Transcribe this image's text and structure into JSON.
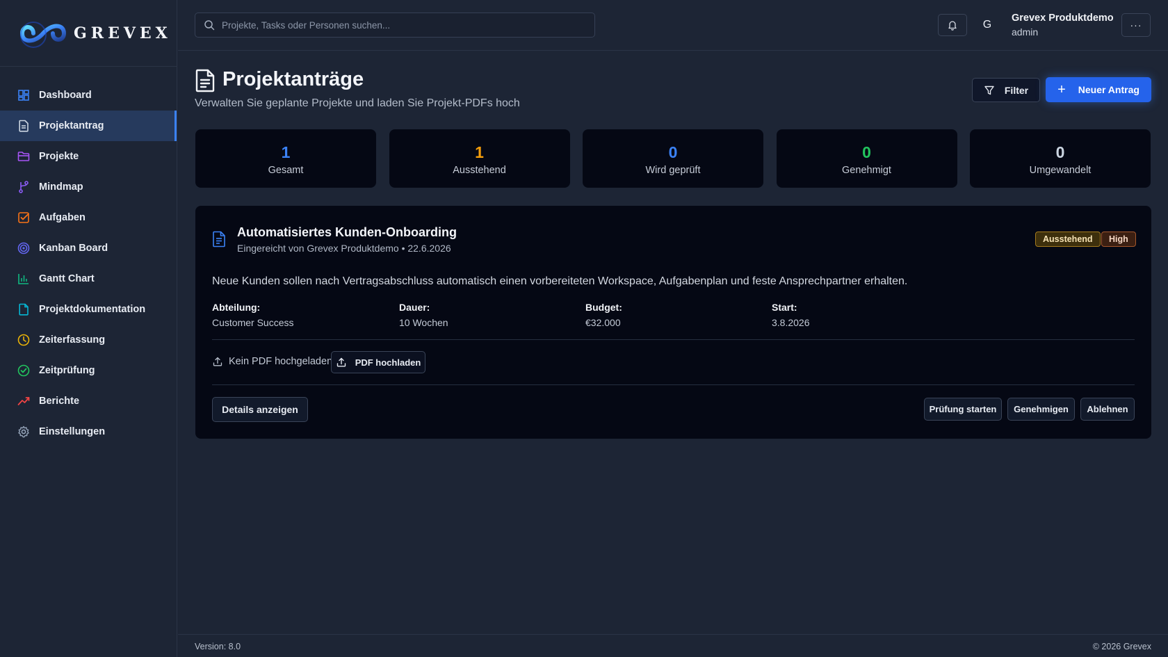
{
  "app": {
    "brand": "GREVEX"
  },
  "sidebar": {
    "items": [
      {
        "label": "Dashboard",
        "icon": "dashboard-icon",
        "color": "#3b82f6"
      },
      {
        "label": "Projektantrag",
        "icon": "document-icon",
        "color": "#cbd5e1",
        "active": true
      },
      {
        "label": "Projekte",
        "icon": "folder-icon",
        "color": "#a855f7"
      },
      {
        "label": "Mindmap",
        "icon": "branch-icon",
        "color": "#8b5cf6"
      },
      {
        "label": "Aufgaben",
        "icon": "checkbox-icon",
        "color": "#f97316"
      },
      {
        "label": "Kanban Board",
        "icon": "target-icon",
        "color": "#6366f1"
      },
      {
        "label": "Gantt Chart",
        "icon": "bar-chart-icon",
        "color": "#10b981"
      },
      {
        "label": "Projektdokumentation",
        "icon": "file-icon",
        "color": "#06b6d4"
      },
      {
        "label": "Zeiterfassung",
        "icon": "clock-icon",
        "color": "#eab308"
      },
      {
        "label": "Zeitprüfung",
        "icon": "check-circle-icon",
        "color": "#22c55e"
      },
      {
        "label": "Berichte",
        "icon": "trend-icon",
        "color": "#ef4444"
      },
      {
        "label": "Einstellungen",
        "icon": "gear-icon",
        "color": "#94a3b8"
      }
    ]
  },
  "topbar": {
    "search_placeholder": "Projekte, Tasks oder Personen suchen...",
    "avatar_letter": "G",
    "user_name": "Grevex Produktdemo",
    "user_role": "admin",
    "more_label": "···"
  },
  "page": {
    "title": "Projektanträge",
    "subtitle": "Verwalten Sie geplante Projekte und laden Sie Projekt-PDFs hoch",
    "filter_label": "Filter",
    "new_label": "Neuer Antrag"
  },
  "stats": [
    {
      "value": "1",
      "label": "Gesamt",
      "color": "#3b82f6"
    },
    {
      "value": "1",
      "label": "Ausstehend",
      "color": "#f59e0b"
    },
    {
      "value": "0",
      "label": "Wird geprüft",
      "color": "#3b82f6"
    },
    {
      "value": "0",
      "label": "Genehmigt",
      "color": "#22c55e"
    },
    {
      "value": "0",
      "label": "Umgewandelt",
      "color": "#cbd5e1"
    }
  ],
  "request": {
    "title": "Automatisiertes Kunden-Onboarding",
    "submitted": "Eingereicht von Grevex Produktdemo • 22.6.2026",
    "status": "Ausstehend",
    "priority": "High",
    "description": "Neue Kunden sollen nach Vertragsabschluss automatisch einen vorbereiteten Workspace, Aufgabenplan und feste Ansprechpartner erhalten.",
    "meta": [
      {
        "key": "Abteilung:",
        "value": "Customer Success"
      },
      {
        "key": "Dauer:",
        "value": "10 Wochen"
      },
      {
        "key": "Budget:",
        "value": "€32.000"
      },
      {
        "key": "Start:",
        "value": "3.8.2026"
      }
    ],
    "pdf_status": "Kein PDF hochgeladen",
    "upload_label": "PDF hochladen",
    "details_label": "Details anzeigen",
    "review_label": "Prüfung starten",
    "approve_label": "Genehmigen",
    "reject_label": "Ablehnen"
  },
  "footer": {
    "version": "Version: 8.0",
    "copyright": "© 2026 Grevex"
  }
}
